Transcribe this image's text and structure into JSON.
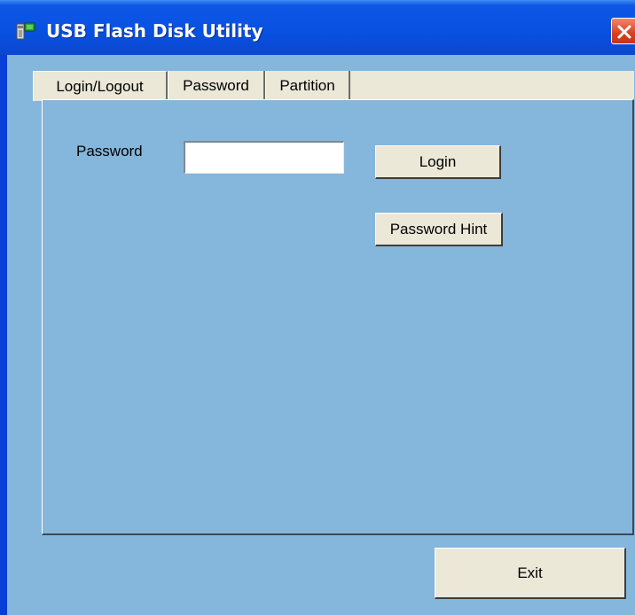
{
  "window": {
    "title": "USB Flash Disk Utility",
    "icon": "usb-disk-icon",
    "close_icon": "close-icon"
  },
  "tabs": [
    {
      "label": "Login/Logout",
      "active": true
    },
    {
      "label": "Password",
      "active": false
    },
    {
      "label": "Partition",
      "active": false
    }
  ],
  "login_panel": {
    "password_label": "Password",
    "password_value": "",
    "login_button": "Login",
    "hint_button": "Password Hint"
  },
  "footer": {
    "exit_button": "Exit"
  },
  "colors": {
    "title_bar": "#0851e2",
    "client_bg": "#85b6dc",
    "button_face": "#ebe8d8",
    "close_button": "#d9401f"
  }
}
